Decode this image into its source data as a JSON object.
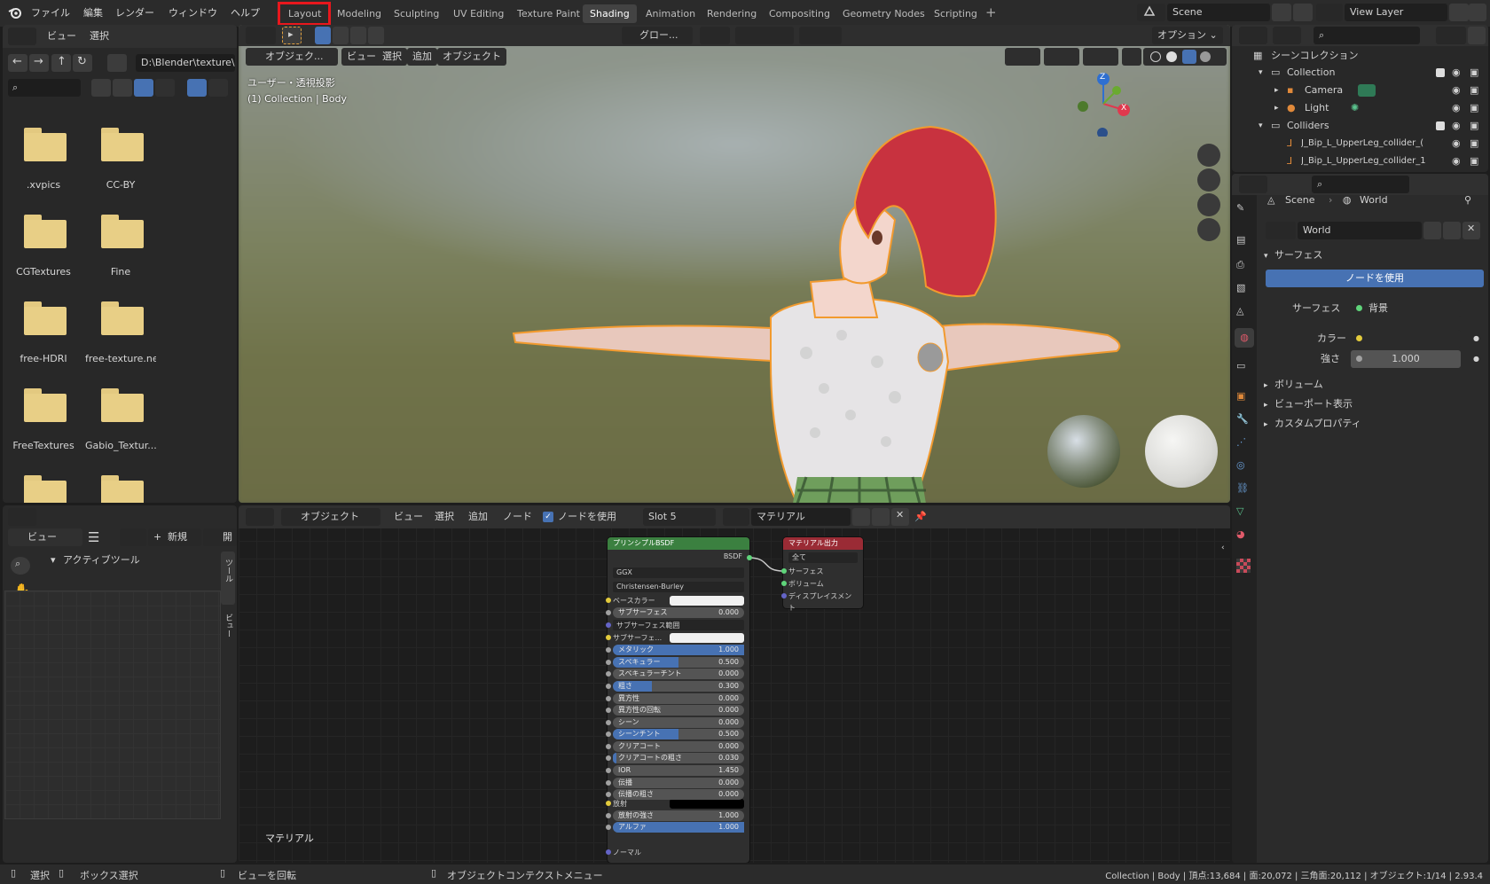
{
  "menu": {
    "file": "ファイル",
    "edit": "編集",
    "render": "レンダー",
    "window": "ウィンドウ",
    "help": "ヘルプ"
  },
  "workspace_tabs": [
    "Layout",
    "Modeling",
    "Sculpting",
    "UV Editing",
    "Texture Paint",
    "Shading",
    "Animation",
    "Rendering",
    "Compositing",
    "Geometry Nodes",
    "Scripting"
  ],
  "active_tab": "Shading",
  "highlighted_tab": "Layout",
  "scene": {
    "name": "Scene",
    "view_layer": "View Layer"
  },
  "file_browser": {
    "view": "ビュー",
    "select": "選択",
    "path": "D:\\Blender\\texture\\",
    "folders": [
      ".xvpics",
      "CC-BY",
      "CGTextures",
      "Fine",
      "free-HDRI",
      "free-texture.ne",
      "FreeTextures",
      "Gabio_Textur..."
    ]
  },
  "viewport": {
    "mode": "オブジェク...",
    "view": "ビュー",
    "select": "選択",
    "add": "追加",
    "object": "オブジェクト",
    "transform": "グロー...",
    "options": "オプション",
    "info_line1": "ユーザー・透視投影",
    "info_line2": "(1) Collection | Body",
    "gizmo_axes": {
      "z": "Z",
      "x": "X"
    }
  },
  "image_editor": {
    "view": "ビュー",
    "new": "新規",
    "open": "開",
    "active_tool": "アクティブツール",
    "tab_tool": "ツール",
    "tab_view": "ビュー"
  },
  "node_editor": {
    "editor_type": "オブジェクト",
    "view": "ビュー",
    "select": "選択",
    "add": "追加",
    "node": "ノード",
    "use_nodes": "ノードを使用",
    "slot": "Slot 5",
    "material": "マテリアル",
    "footer_label": "マテリアル",
    "bsdf": {
      "title": "プリンシプルBSDF",
      "output": "BSDF",
      "distribution": "GGX",
      "subsurface_method": "Christensen-Burley",
      "base_color": "ベースカラー",
      "subsurface_radius": "サブサーフェス範囲",
      "subsurface_color": "サブサーフェ...",
      "emission": "放射",
      "normal": "ノーマル",
      "sliders": [
        {
          "label": "サブサーフェス",
          "value": "0.000",
          "fill": 0
        },
        {
          "label": "メタリック",
          "value": "1.000",
          "fill": 1
        },
        {
          "label": "スペキュラー",
          "value": "0.500",
          "fill": 0.5
        },
        {
          "label": "スペキュラーチント",
          "value": "0.000",
          "fill": 0
        },
        {
          "label": "粗さ",
          "value": "0.300",
          "fill": 0.3
        },
        {
          "label": "異方性",
          "value": "0.000",
          "fill": 0
        },
        {
          "label": "異方性の回転",
          "value": "0.000",
          "fill": 0
        },
        {
          "label": "シーン",
          "value": "0.000",
          "fill": 0
        },
        {
          "label": "シーンチント",
          "value": "0.500",
          "fill": 0.5
        },
        {
          "label": "クリアコート",
          "value": "0.000",
          "fill": 0
        },
        {
          "label": "クリアコートの粗さ",
          "value": "0.030",
          "fill": 0.03
        },
        {
          "label": "IOR",
          "value": "1.450",
          "fill": 0
        },
        {
          "label": "伝播",
          "value": "0.000",
          "fill": 0
        },
        {
          "label": "伝播の粗さ",
          "value": "0.000",
          "fill": 0
        }
      ],
      "emission_strength": {
        "label": "放射の強さ",
        "value": "1.000",
        "fill": 0
      },
      "alpha": {
        "label": "アルファ",
        "value": "1.000",
        "fill": 1
      }
    },
    "output": {
      "title": "マテリアル出力",
      "target": "全て",
      "surface": "サーフェス",
      "volume": "ボリューム",
      "displacement": "ディスプレイスメント"
    }
  },
  "outliner": {
    "root": "シーンコレクション",
    "items": [
      {
        "label": "Collection"
      },
      {
        "label": "Camera"
      },
      {
        "label": "Light"
      },
      {
        "label": "Colliders"
      },
      {
        "label": "J_Bip_L_UpperLeg_collider_("
      },
      {
        "label": "J_Bip_L_UpperLeg_collider_1"
      }
    ]
  },
  "properties": {
    "breadcrumb_scene": "Scene",
    "breadcrumb_world": "World",
    "world_name": "World",
    "surface_panel": "サーフェス",
    "use_nodes": "ノードを使用",
    "surface_label": "サーフェス",
    "surface_value": "背景",
    "color_label": "カラー",
    "strength_label": "強さ",
    "strength_value": "1.000",
    "volume_panel": "ボリューム",
    "viewport_display": "ビューポート表示",
    "custom_props": "カスタムプロパティ"
  },
  "status_bar": {
    "select": "選択",
    "box_select": "ボックス選択",
    "rotate_view": "ビューを回転",
    "context_menu": "オブジェクトコンテクストメニュー",
    "stats": "Collection | Body | 頂点:13,684 | 面:20,072 | 三角面:20,112 | オブジェクト:1/14 | 2.93.4"
  },
  "colors": {
    "accent": "#4772b3",
    "highlight": "#e8171d",
    "hair": "#c8323f",
    "outline": "#f29a2e",
    "bsdf_header": "#3b8040",
    "output_header": "#9a2b35"
  }
}
